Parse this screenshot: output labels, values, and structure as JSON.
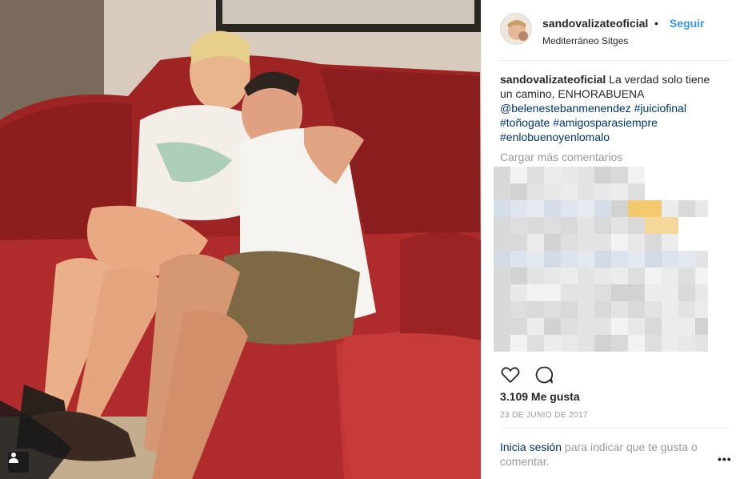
{
  "post": {
    "username": "sandovalizateoficial",
    "separator": "•",
    "follow_label": "Seguir",
    "location": "Mediterráneo Sitges",
    "caption": {
      "username": "sandovalizateoficial",
      "text": " La verdad solo tiene un camino, ENHORABUENA ",
      "links": [
        "@belenestebanmenendez",
        "#juiciofinal",
        "#toñogate",
        "#amigosparasiempre",
        "#enlobuenoyenlomalo"
      ]
    },
    "load_more_label": "Cargar más comentarios",
    "likes": "3.109 Me gusta",
    "date": "23 DE JUNIO DE 2017",
    "login_prompt": {
      "link": "Inicia sesión",
      "text": " para indicar que te gusta o comentar."
    },
    "more_label": "•••"
  },
  "icons": {
    "like": "heart-icon",
    "comment": "comment-icon",
    "tag": "user-tag-icon"
  },
  "colors": {
    "link": "#003569",
    "follow": "#3897f0",
    "muted": "#999999",
    "text": "#262626",
    "sofa": "#a52a2a"
  }
}
